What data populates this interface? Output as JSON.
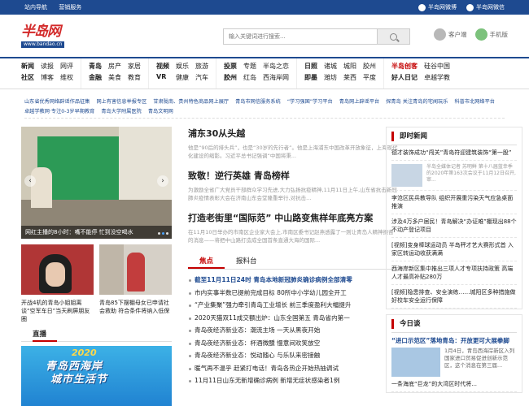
{
  "topbar": {
    "left": [
      "站内导航",
      "营销服务"
    ],
    "right": [
      "半岛网微博",
      "半岛网微信"
    ]
  },
  "logo": {
    "text": "半岛网",
    "url": "www.bandao.cn"
  },
  "search": {
    "placeholder": "输入关键词进行搜索..."
  },
  "header_links": [
    "客户端",
    "手机版"
  ],
  "nav": [
    {
      "items": [
        {
          "t": "新闻",
          "s": "b"
        },
        {
          "t": "读报"
        },
        {
          "t": "网评"
        },
        {
          "t": "社区",
          "s": "b"
        },
        {
          "t": "博客"
        },
        {
          "t": "维权"
        }
      ]
    },
    {
      "items": [
        {
          "t": "青岛",
          "s": "b"
        },
        {
          "t": "房产"
        },
        {
          "t": "家居"
        },
        {
          "t": "金融",
          "s": "b"
        },
        {
          "t": "美食"
        },
        {
          "t": "教育"
        }
      ]
    },
    {
      "items": [
        {
          "t": "视频",
          "s": "b"
        },
        {
          "t": "娱乐"
        },
        {
          "t": "旅游"
        },
        {
          "t": "VR",
          "s": "b"
        },
        {
          "t": "健康"
        },
        {
          "t": "汽车"
        }
      ]
    },
    {
      "items": [
        {
          "t": "投票",
          "s": "b"
        },
        {
          "t": "专题"
        },
        {
          "t": "半岛之恋"
        },
        {
          "t": "胶州",
          "s": "b"
        },
        {
          "t": "红岛"
        },
        {
          "t": "西海岸网"
        }
      ]
    },
    {
      "items": [
        {
          "t": "日照",
          "s": "b"
        },
        {
          "t": "诸城"
        },
        {
          "t": "城阳"
        },
        {
          "t": "胶州"
        },
        {
          "t": "即墨",
          "s": "b"
        },
        {
          "t": "潍坊"
        },
        {
          "t": "莱西"
        },
        {
          "t": "平度"
        }
      ],
      "cols": 4
    },
    {
      "items": [
        {
          "t": "半岛创客",
          "s": "r"
        },
        {
          "t": "硅谷中国"
        },
        {
          "t": "好人日记",
          "s": "b"
        },
        {
          "t": "卓越学教"
        }
      ],
      "cols": 2
    }
  ],
  "links": [
    "山东省优秀网络辟谣作品征集",
    "网上有害信息举报专区",
    "甘肃陇南、贵州特色商品网上展厅",
    "青岛市网信服务系统",
    "“学习强国”学习平台",
    "青岛网上辟谣平台",
    "探青岛 关注青岛的宅闻玩乐",
    "科普市北网络平台",
    "卓越学教网·专注0-3岁早期教育",
    "青岛大学附属医院",
    "青岛文明网"
  ],
  "carousel": {
    "caption": "网红主播的8小时：嘴不能停 忙到没空喝水",
    "prev": "‹",
    "next": "›"
  },
  "thumbs": [
    {
      "caption": "开战4机的青岛小姐姐离谈“空军车日”当天刷屏朋友圈"
    },
    {
      "caption": "青岛85下摆棚母女已申请社会救助 符合条件将纳入低保"
    }
  ],
  "live": {
    "title": "直播",
    "year": "2020",
    "line1": "青岛西海岸",
    "line2": "城市生活节"
  },
  "mid": {
    "stories": [
      {
        "title": "浦东30从头越",
        "summary": "他是“90后的排头兵”，也是“30岁的先行者”。他是上海浦东中国改革开放象征，上海现代化建设的缩影。习近平总书记强调“中国将秉..."
      },
      {
        "title": "致敬！逆行英雄 青岛榜样",
        "summary": "为激励全省广大党员干部群众学习先进,大力弘扬抗疫精神,11月11日上午,山东省抗击新冠肺炎疫情表彰大会在济南山东会堂隆重举行,对抗击..."
      },
      {
        "title": "打造老街里“国际范” 中山路变焦样年底亮方案",
        "summary": "在11月10日举办的市南区企业家大会上,市南区委书记赵燕透露了一则让青岛人精神振奋的消息——将把中山路打造成全国首条直通大海的国际..."
      }
    ],
    "tabs": [
      "焦点",
      "报料台"
    ],
    "news": [
      "截至11月11日24时 青岛本地新冠肺炎确诊病例全部清零",
      "市内实事半数已提前完成目标 80所中小学幼儿园全开工",
      "“产业集聚”强力牵引青岛工业增长 前三季度盈利大幅提升",
      "2020天猫双11成交额出炉：山东全国第五 青岛省内第一",
      "青岛夜经济新业态：潮流主场 一天从黑夜开始",
      "青岛夜经济新业态：杯酒微醺 慢意间欢笑放空",
      "青岛夜经济新业态：悦动随心 与乐队来密接触",
      "暖气再不温乎 赶紧打电话！青岛各热企开始热抽调试",
      "11月11日山东无新增确诊病例 新增无症状感染者1例"
    ]
  },
  "side": {
    "title": "即时新闻",
    "items": [
      {
        "text": "德才装饰成功“闯关”青岛符迎建筑装饰“第一股”"
      },
      {
        "text": "",
        "sub": "半岛全媒体记者 苏明鲜 第十八届蓝幸季的2020年第163次会议于11月12日召开, 审..."
      },
      {
        "text": "李沧区民兵教导队 组织开展重污染天气应急桌面推演"
      },
      {
        "text": "涉及4万多户居民！青岛解决“办证难”棚现出88个不动产登记项目"
      },
      {
        "text": "[视频]变身棒球运动员 半岛秤才艺大赛形式首 入家区转运动收获满满"
      },
      {
        "text": "西海岸新区集中推出三项人才专项扶持政策 高端人才最高补贴280万"
      },
      {
        "text": "[视频]隐患排查、安全演练……城阳区多种措施做好校车安全运行保障"
      }
    ],
    "today": {
      "title": "今日谈",
      "headline": "“进口示范区”落地青岛：开放更可大展拳脚",
      "body": "1月4日，青岛西海岸新区入列国家进口贸易促进创新示范区，这个消息在第三届...",
      "more": "一条海底“巨龙”的大湾区时代将..."
    }
  }
}
